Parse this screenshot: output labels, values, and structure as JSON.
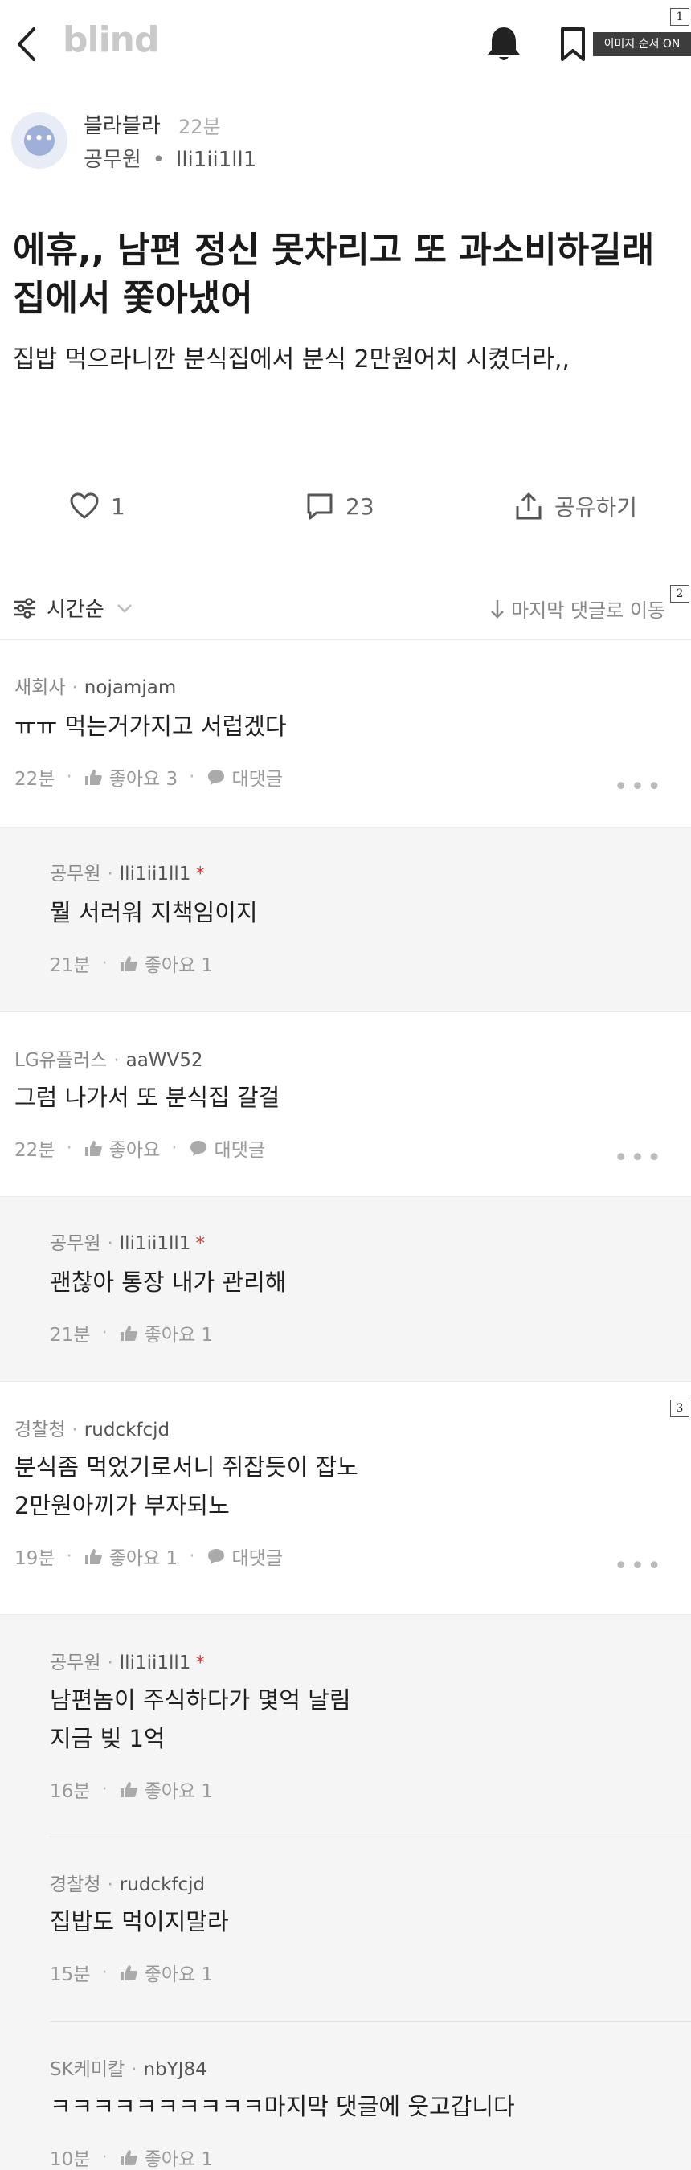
{
  "header": {
    "logo": "blind",
    "image_order_badge": "이미지 순서 ON",
    "badge_1": "1",
    "badge_2": "2",
    "badge_3": "3"
  },
  "author": {
    "name": "블라블라",
    "time": "22분",
    "company": "공무원",
    "nickname": "lli1ii1ll1"
  },
  "post": {
    "title_line1": "에휴,, 남편 정신 못차리고 또 과소비하길래",
    "title_line2": "집에서 쫓아냈어",
    "body": "집밥 먹으라니깐 분식집에서 분식 2만원어치 시켰더라,,"
  },
  "actions": {
    "like_count": "1",
    "comment_count": "23",
    "share_label": "공유하기"
  },
  "sort": {
    "order_label": "시간순",
    "jump_label": "마지막 댓글로 이동"
  },
  "comments": [
    {
      "company": "새회사",
      "nickname": "nojamjam",
      "text": "ㅠㅠ 먹는거가지고 서럽겠다",
      "time": "22분",
      "like": "좋아요 3",
      "reply": "대댓글"
    },
    {
      "company": "공무원",
      "nickname": "lli1ii1ll1",
      "author_mark": "*",
      "text": "뭘 서러워 지책임이지",
      "time": "21분",
      "like": "좋아요 1"
    },
    {
      "company": "LG유플러스",
      "nickname": "aaWV52",
      "text": "그럼 나가서 또 분식집 갈걸",
      "time": "22분",
      "like": "좋아요",
      "reply": "대댓글"
    },
    {
      "company": "공무원",
      "nickname": "lli1ii1ll1",
      "author_mark": "*",
      "text": "괜찮아 통장 내가 관리해",
      "time": "21분",
      "like": "좋아요 1"
    },
    {
      "company": "경찰청",
      "nickname": "rudckfcjd",
      "text_line1": "분식좀 먹었기로서니 쥐잡듯이 잡노",
      "text_line2": "2만원아끼가 부자되노",
      "time": "19분",
      "like": "좋아요 1",
      "reply": "대댓글"
    },
    {
      "company": "공무원",
      "nickname": "lli1ii1ll1",
      "author_mark": "*",
      "text_line1": "남편놈이 주식하다가 몇억 날림",
      "text_line2": "지금 빚 1억",
      "time": "16분",
      "like": "좋아요 1"
    },
    {
      "company": "경찰청",
      "nickname": "rudckfcjd",
      "text": "집밥도 먹이지말라",
      "time": "15분",
      "like": "좋아요 1"
    },
    {
      "company": "SK케미칼",
      "nickname": "nbYJ84",
      "text": "ㅋㅋㅋㅋㅋㅋㅋㅋㅋㅋ마지막 댓글에 웃고갑니다",
      "time": "10분",
      "like": "좋아요 1"
    }
  ],
  "colors": {
    "accent_red": "#dd3333",
    "reply_bg": "#f5f5f5",
    "logo_gray": "#c9c9c9"
  }
}
